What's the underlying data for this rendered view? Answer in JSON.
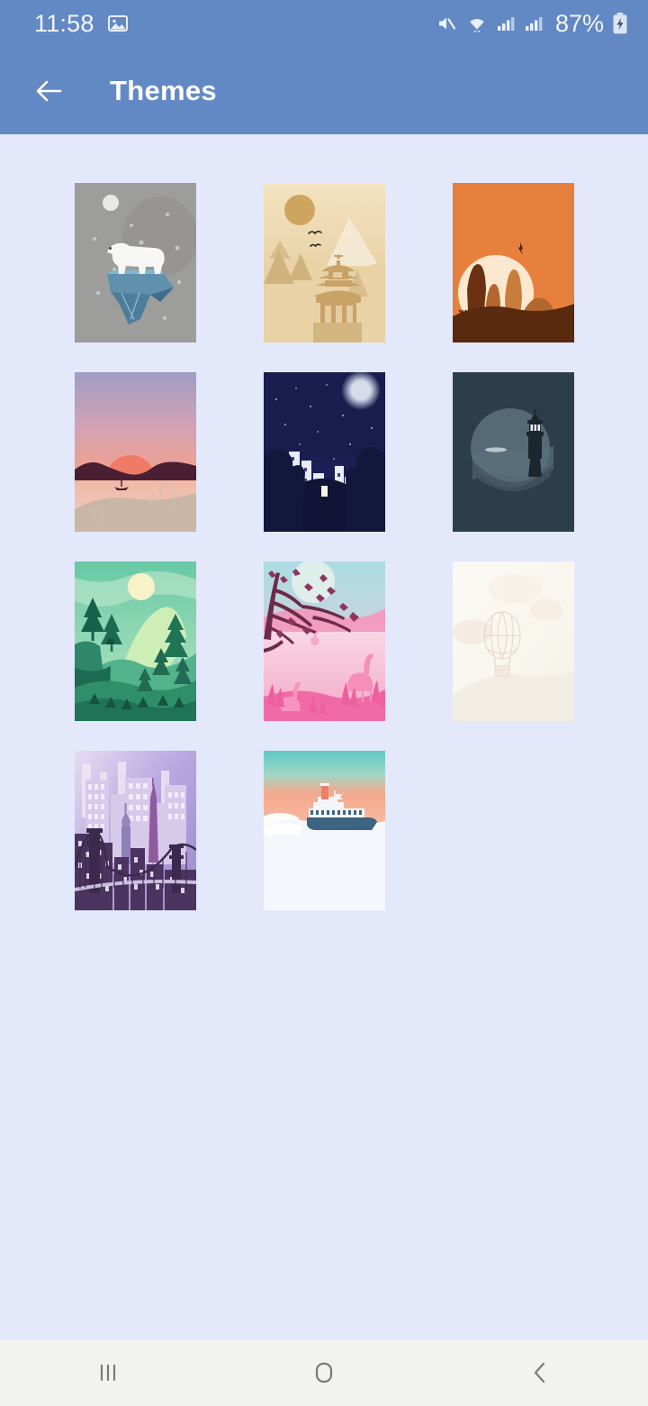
{
  "status_bar": {
    "time": "11:58",
    "battery_percent": "87%",
    "left_icons": [
      {
        "name": "screenshot-image-icon",
        "glyph": "image"
      }
    ],
    "right_icons": [
      {
        "name": "mute-icon",
        "glyph": "speaker-muted"
      },
      {
        "name": "wifi-icon",
        "glyph": "wifi-transfer"
      },
      {
        "name": "signal-sim1-icon",
        "glyph": "signal-bars"
      },
      {
        "name": "signal-sim2-icon",
        "glyph": "signal-bars"
      },
      {
        "name": "battery-charging-icon",
        "glyph": "battery-bolt"
      }
    ],
    "colors": {
      "background": "#6389c4",
      "text": "#f2f5fb"
    }
  },
  "app_bar": {
    "back_label": "Back",
    "back_icon": "arrow-left-icon",
    "title": "Themes",
    "colors": {
      "background": "#6389c4",
      "title": "#ffffff"
    }
  },
  "page": {
    "background_color": "#e3e8fb",
    "columns": 3
  },
  "themes": [
    {
      "id": "polar-bear",
      "name": "Polar Bear Iceberg",
      "position": 1,
      "row": 1,
      "col": 1,
      "dominant_color": "#9e9e9e"
    },
    {
      "id": "pagoda",
      "name": "Golden Pagoda",
      "position": 2,
      "row": 1,
      "col": 2,
      "dominant_color": "#e3c996"
    },
    {
      "id": "desert",
      "name": "Desert Sunset",
      "position": 3,
      "row": 1,
      "col": 3,
      "dominant_color": "#e8803d"
    },
    {
      "id": "lake-sunset",
      "name": "Lake Sunset Boat",
      "position": 4,
      "row": 2,
      "col": 1,
      "dominant_color": "#eda298"
    },
    {
      "id": "night-city",
      "name": "Moonlit Night City",
      "position": 5,
      "row": 2,
      "col": 2,
      "dominant_color": "#1c1f50"
    },
    {
      "id": "lighthouse",
      "name": "Lighthouse Dusk",
      "position": 6,
      "row": 2,
      "col": 3,
      "dominant_color": "#2c3d4a"
    },
    {
      "id": "green-valley",
      "name": "Green Forest Valley",
      "position": 7,
      "row": 3,
      "col": 1,
      "dominant_color": "#4fb894"
    },
    {
      "id": "flamingo",
      "name": "Pink Flamingo Blossom",
      "position": 8,
      "row": 3,
      "col": 2,
      "dominant_color": "#f285b0"
    },
    {
      "id": "balloon",
      "name": "Pale Hot Air Balloon",
      "position": 9,
      "row": 3,
      "col": 3,
      "dominant_color": "#faf8f3"
    },
    {
      "id": "purple-city",
      "name": "Purple City Bridge",
      "position": 10,
      "row": 4,
      "col": 1,
      "dominant_color": "#9a86c8"
    },
    {
      "id": "ship",
      "name": "Ship at Sunrise",
      "position": 11,
      "row": 4,
      "col": 2,
      "dominant_color": "#f0a58c"
    }
  ],
  "nav_bar": {
    "background_color": "#f2f2f0",
    "buttons": [
      {
        "name": "recents-button",
        "icon": "recents-icon",
        "label": "Recents"
      },
      {
        "name": "home-button",
        "icon": "home-icon",
        "label": "Home"
      },
      {
        "name": "back-button",
        "icon": "back-chevron-icon",
        "label": "Back"
      }
    ]
  }
}
